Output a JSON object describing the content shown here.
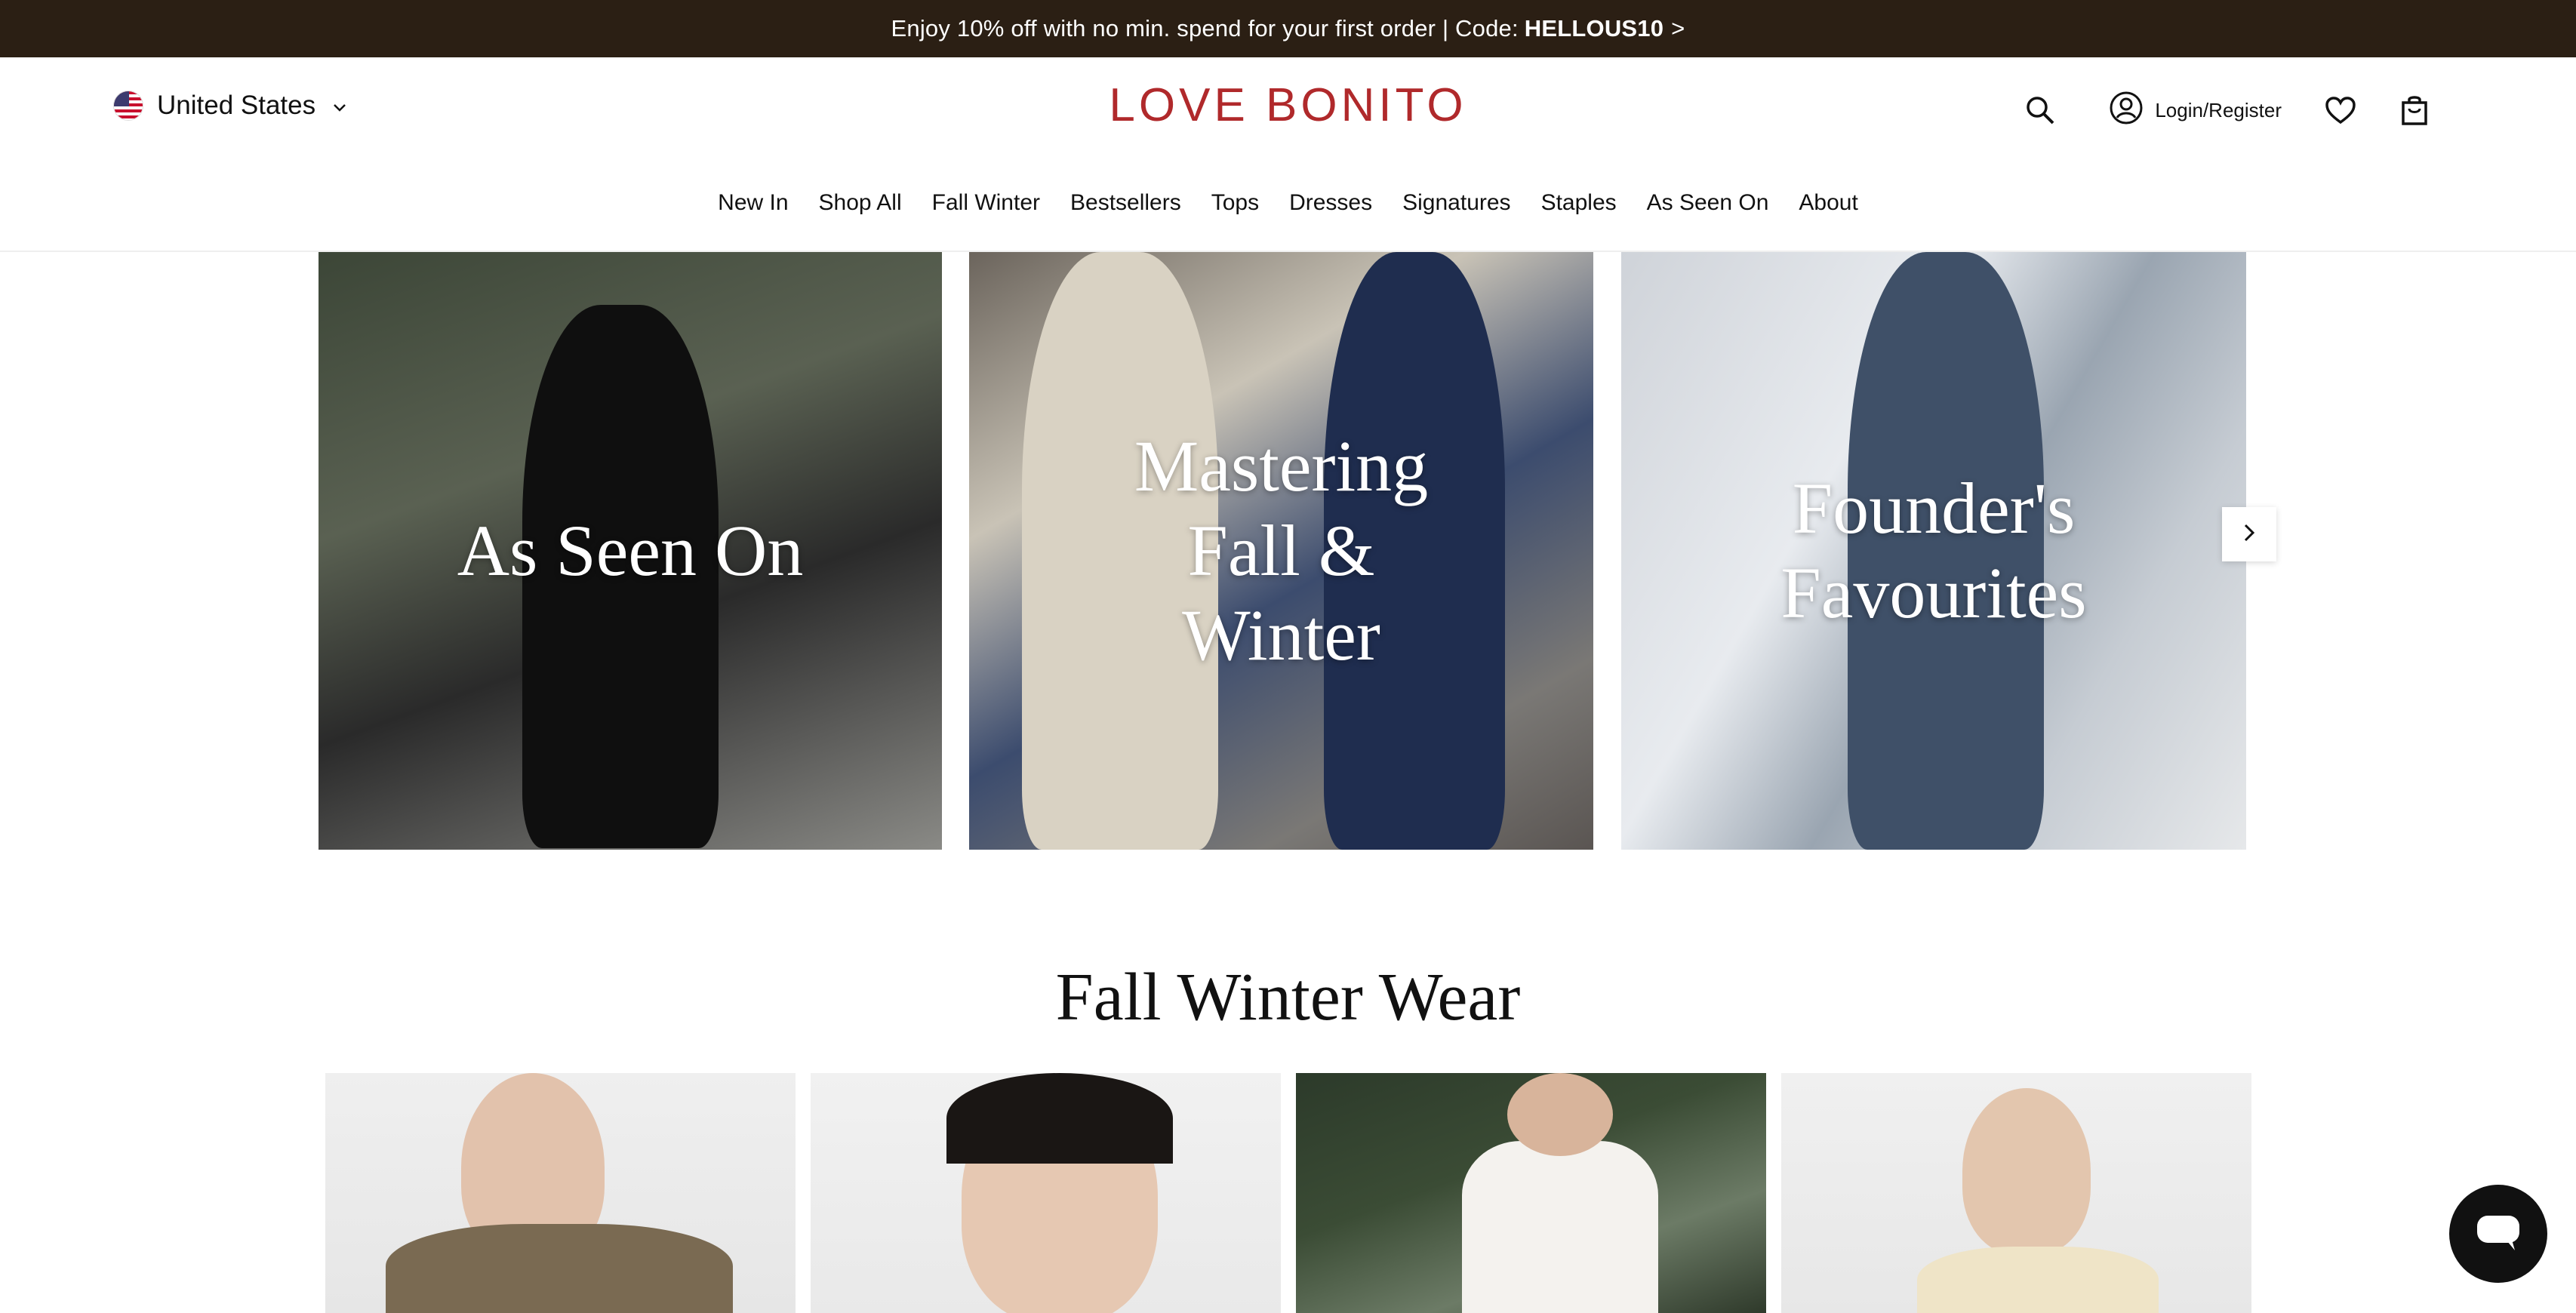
{
  "promo": {
    "text": "Enjoy 10% off with no min. spend for your first order | Code:",
    "code": "HELLOUS10",
    "arrow": ">"
  },
  "header": {
    "country": "United States",
    "logo": "LOVE BONITO",
    "login_label": "Login/Register"
  },
  "nav": {
    "items": [
      "New In",
      "Shop All",
      "Fall Winter",
      "Bestsellers",
      "Tops",
      "Dresses",
      "Signatures",
      "Staples",
      "As Seen On",
      "About"
    ]
  },
  "carousel": {
    "tiles": [
      {
        "title": "As Seen On"
      },
      {
        "title": "Mastering Fall & Winter"
      },
      {
        "title": "Founder's Favourites"
      }
    ]
  },
  "section": {
    "title": "Fall Winter Wear"
  },
  "icons": {
    "search": "search-icon",
    "account": "user-icon",
    "wishlist": "heart-icon",
    "cart": "bag-icon",
    "next": "chevron-right-icon",
    "chat": "chat-icon",
    "flag": "us-flag-icon",
    "dropdown": "chevron-down-icon"
  },
  "colors": {
    "promo_bg": "#2b1f14",
    "logo": "#b0292b"
  }
}
